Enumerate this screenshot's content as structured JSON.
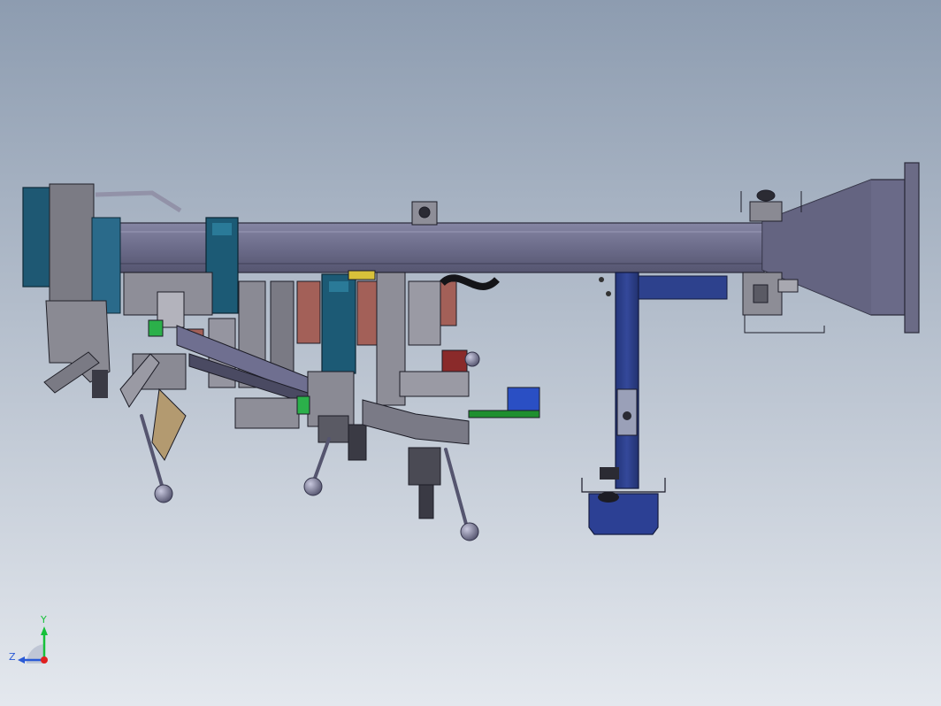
{
  "colors": {
    "background_top": "#8d9cb0",
    "background_bottom": "#e4e8ee",
    "beam": "#6e6e8c",
    "teal_bracket": "#1c5a75",
    "column": "#2c3f8c",
    "gray_metal": "#7d7d86",
    "copper": "#a36058",
    "green_part": "#1f8f2f",
    "blue_fixture": "#2a4fc4",
    "axis_x": "#e02020",
    "axis_y": "#16c13a",
    "axis_z": "#2a5ad6"
  },
  "triad": {
    "y_label": "Y",
    "z_label": "Z"
  }
}
